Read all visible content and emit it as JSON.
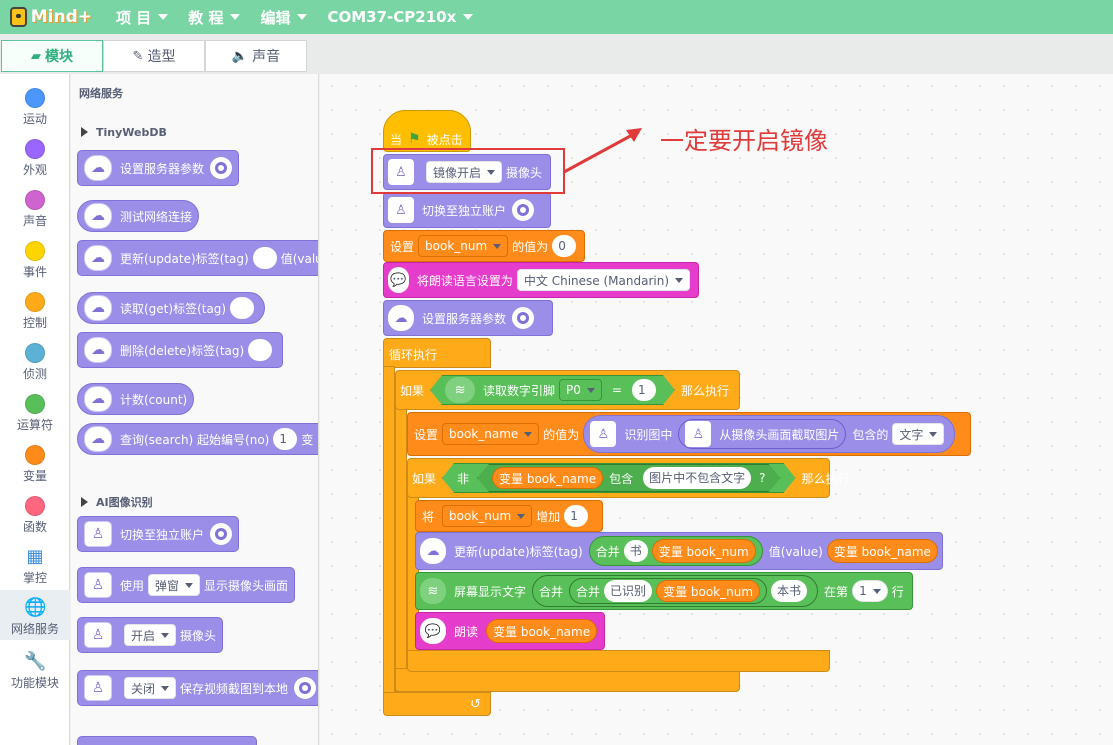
{
  "topbar": {
    "logo": "Mind+",
    "menus": [
      "项 目",
      "教 程",
      "编辑",
      "COM37-CP210x"
    ]
  },
  "tabs": [
    {
      "label": "模块",
      "icon": "blocks-icon"
    },
    {
      "label": "造型",
      "icon": "brush-icon"
    },
    {
      "label": "声音",
      "icon": "speaker-icon"
    }
  ],
  "categories": [
    {
      "label": "运动",
      "color": "#4c97ff"
    },
    {
      "label": "外观",
      "color": "#9966ff"
    },
    {
      "label": "声音",
      "color": "#cf63cf"
    },
    {
      "label": "事件",
      "color": "#ffd500"
    },
    {
      "label": "控制",
      "color": "#ffab19"
    },
    {
      "label": "侦测",
      "color": "#5cb1d6"
    },
    {
      "label": "运算符",
      "color": "#59c059"
    },
    {
      "label": "变量",
      "color": "#ff8c1a"
    },
    {
      "label": "函数",
      "color": "#ff6680"
    },
    {
      "label": "掌控",
      "icon": "chip-icon"
    },
    {
      "label": "网络服务",
      "icon": "globe-icon"
    },
    {
      "label": "功能模块",
      "icon": "wrench-icon"
    }
  ],
  "palette": {
    "section": "网络服务",
    "tinywebdb": "TinyWebDB",
    "b1": "设置服务器参数",
    "b2": "测试网络连接",
    "b3a": "更新(update)标签(tag)",
    "b3b": "值(valu",
    "b4": "读取(get)标签(tag)",
    "b5": "删除(delete)标签(tag)",
    "b6": "计数(count)",
    "b7a": "查询(search) 起始编号(no)",
    "b7b": "1",
    "b7c": "变",
    "ai": "AI图像识别",
    "c1": "切换至独立账户",
    "c2a": "使用",
    "c2b": "弹窗",
    "c2c": "显示摄像头画面",
    "c3a": "开启",
    "c3b": "摄像头",
    "c4a": "关闭",
    "c4b": "保存视频截图到本地"
  },
  "script": {
    "hat_a": "当",
    "hat_b": "被点击",
    "mirror_dd": "镜像开启",
    "mirror_b": "摄像头",
    "switch": "切换至独立账户",
    "set1_a": "设置",
    "set1_var": "book_num",
    "set1_b": "的值为",
    "set1_val": "0",
    "tts_a": "将朗读语言设置为",
    "tts_dd": "中文 Chinese (Mandarin)",
    "server": "设置服务器参数",
    "loop": "循环执行",
    "if1_a": "如果",
    "if1_read": "读取数字引脚",
    "if1_pin": "P0",
    "if1_eq": "=",
    "if1_val": "1",
    "if1_then": "那么执行",
    "set2_a": "设置",
    "set2_var": "book_name",
    "set2_b": "的值为",
    "set2_ocr": "识别图中",
    "set2_cap": "从摄像头画面截取图片",
    "set2_c": "包含的",
    "set2_dd": "文字",
    "if2_a": "如果",
    "if2_not": "非",
    "if2_var": "变量 book_name",
    "if2_b": "包含",
    "if2_str": "图片中不包含文字",
    "if2_q": "?",
    "if2_then": "那么执行",
    "inc_a": "将",
    "inc_var": "book_num",
    "inc_b": "增加",
    "inc_val": "1",
    "upd_a": "更新(update)标签(tag)",
    "upd_join": "合并",
    "upd_str": "书",
    "upd_var": "变量 book_num",
    "upd_b": "值(value)",
    "upd_var2": "变量 book_name",
    "disp_a": "屏幕显示文字",
    "disp_join1": "合并",
    "disp_join2": "合并",
    "disp_str1": "已识别",
    "disp_var": "变量 book_num",
    "disp_str2": "本书",
    "disp_b": "在第",
    "disp_row": "1",
    "disp_c": "行",
    "speak_a": "朗读",
    "speak_var": "变量 book_name"
  },
  "annotation": "一定要开启镜像"
}
